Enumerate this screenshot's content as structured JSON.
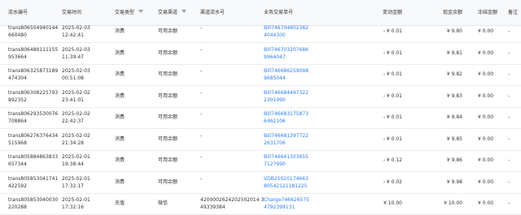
{
  "columns": {
    "trans_id": "流水编号",
    "time": "交易时间",
    "type": "交易类型",
    "channel": "交易渠道",
    "channel_no": "渠道流水号",
    "biz_no": "业务交易单号",
    "change": "变动金额",
    "cash_balance": "现金余额",
    "frozen": "冻结金额",
    "remark": "备注"
  },
  "filter_icons": [
    "filter-icon",
    "filter-icon"
  ],
  "rows": [
    {
      "id1": "trans806504940144",
      "id2": "660480",
      "date": "2025-02-03",
      "clock": "12:42:41",
      "type": "消费",
      "channel": "可用余额",
      "channel_no1": "-",
      "channel_no2": "",
      "biz1": "Bill746704802382",
      "biz2": "4044300",
      "change": "- ¥ 0.01",
      "cash": "¥ 9.80",
      "frozen": "¥ 0.00",
      "remark": "-"
    },
    {
      "id1": "trans806489111155",
      "id2": "953664",
      "date": "2025-02-03",
      "clock": "11:39:47",
      "type": "消费",
      "channel": "可用余额",
      "channel_no1": "-",
      "channel_no2": "",
      "biz1": "Bill746703207686",
      "biz2": "9964047",
      "change": "- ¥ 0.01",
      "cash": "¥ 9.81",
      "frozen": "¥ 0.00",
      "remark": "-"
    },
    {
      "id1": "trans806325873189",
      "id2": "474304",
      "date": "2025-02-03",
      "clock": "00:51:08",
      "type": "消费",
      "channel": "可用余额",
      "channel_no1": "-",
      "channel_no2": "",
      "biz1": "Bill746686259098",
      "biz2": "9685044",
      "change": "- ¥ 0.01",
      "cash": "¥ 9.82",
      "frozen": "¥ 0.00",
      "remark": "-"
    },
    {
      "id1": "trans806308225793",
      "id2": "892352",
      "date": "2025-02-02",
      "clock": "23:41:01",
      "type": "消费",
      "channel": "可用余额",
      "channel_no1": "-",
      "channel_no2": "",
      "biz1": "Bill746684497322",
      "biz2": "2301990",
      "change": "- ¥ 0.01",
      "cash": "¥ 9.83",
      "frozen": "¥ 0.00",
      "remark": "-"
    },
    {
      "id1": "trans806293530076",
      "id2": "708864",
      "date": "2025-02-02",
      "clock": "22:42:37",
      "type": "消费",
      "channel": "可用余额",
      "channel_no1": "-",
      "channel_no2": "",
      "biz1": "Bill746683175873",
      "biz2": "6462106",
      "change": "- ¥ 0.01",
      "cash": "¥ 9.84",
      "frozen": "¥ 0.00",
      "remark": "-"
    },
    {
      "id1": "trans806276376434",
      "id2": "515968",
      "date": "2025-02-02",
      "clock": "21:34:28",
      "type": "消费",
      "channel": "可用余额",
      "channel_no1": "-",
      "channel_no2": "",
      "biz1": "Bill746681397722",
      "biz2": "2631706",
      "change": "- ¥ 0.01",
      "cash": "¥ 9.85",
      "frozen": "¥ 0.00",
      "remark": "-"
    },
    {
      "id1": "trans805884863833",
      "id2": "657344",
      "date": "2025-02-01",
      "clock": "19:38:44",
      "type": "消费",
      "channel": "可用余额",
      "channel_no1": "-",
      "channel_no2": "",
      "biz1": "Bill746641303655",
      "biz2": "7127990",
      "change": "- ¥ 0.12",
      "cash": "¥ 9.86",
      "frozen": "¥ 0.00",
      "remark": "-"
    },
    {
      "id1": "trans805853041741",
      "id2": "422592",
      "date": "2025-02-01",
      "clock": "17:32:17",
      "type": "消费",
      "channel": "可用余额",
      "channel_no1": "-",
      "channel_no2": "",
      "biz1": "VDB25020174663",
      "biz2": "80542121181225",
      "change": "- ¥ 0.02",
      "cash": "¥ 9.98",
      "frozen": "¥ 0.00",
      "remark": "-"
    },
    {
      "id1": "trans805853040030",
      "id2": "220288",
      "date": "2025-02-01",
      "clock": "17:32:16",
      "type": "充值",
      "channel": "微信",
      "channel_no1": "4200002624202502014 3",
      "channel_no2": "49339384",
      "biz1": "Charge746626575",
      "biz2": "4792399131",
      "change": "¥ 10.00",
      "cash": "¥ 10.00",
      "frozen": "¥ 0.00",
      "remark": "-"
    }
  ],
  "colors": {
    "link": "#2d7df6",
    "header_bg": "#f7f8fa",
    "border": "#ececec"
  }
}
